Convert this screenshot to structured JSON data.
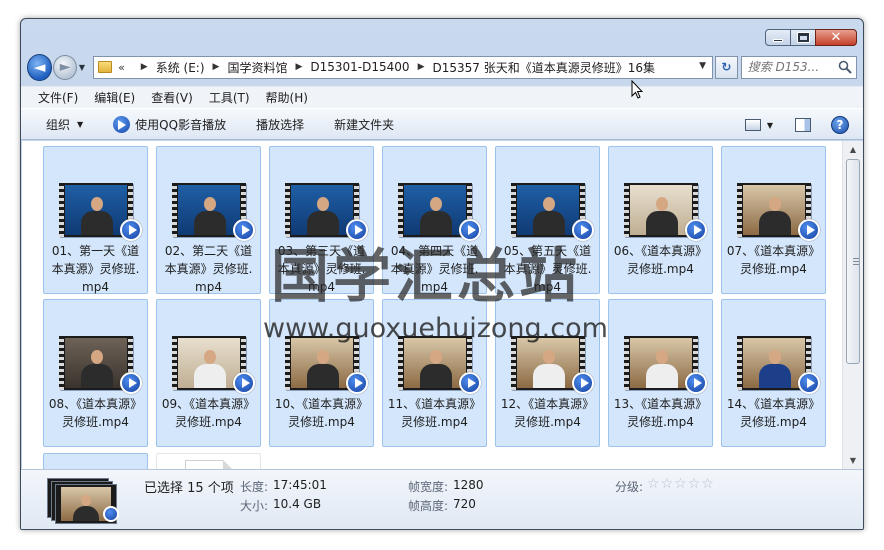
{
  "window": {
    "min_label": "",
    "close_glyph": "✕"
  },
  "nav": {
    "back_glyph": "◄",
    "forward_glyph": "►",
    "history_glyph": "▼"
  },
  "address": {
    "lead": "«",
    "crumbs": [
      "系统 (E:)",
      "国学资料馆",
      "D15301-D15400",
      "D15357 张天和《道本真源灵修班》16集"
    ],
    "separator": "▶",
    "dropdown_glyph": "▼",
    "refresh_glyph": "↻"
  },
  "search": {
    "placeholder": "搜索 D153..."
  },
  "menu": {
    "items": [
      "文件(F)",
      "编辑(E)",
      "查看(V)",
      "工具(T)",
      "帮助(H)"
    ]
  },
  "commands": {
    "organize": "组织",
    "organize_caret": "▼",
    "play_qq": "使用QQ影音播放",
    "play_selection": "播放选择",
    "new_folder": "新建文件夹",
    "views_caret": "▼",
    "help": "?"
  },
  "files": [
    {
      "name": "01、第一天《道本真源》灵修班.mp4",
      "frame": "blue",
      "body": "dark"
    },
    {
      "name": "02、第二天《道本真源》灵修班.mp4",
      "frame": "blue",
      "body": "dark"
    },
    {
      "name": "03、第三天《道本真源》灵修班.mp4",
      "frame": "blue",
      "body": "dark"
    },
    {
      "name": "04、第四天《道本真源》灵修班.mp4",
      "frame": "blue",
      "body": "dark"
    },
    {
      "name": "05、第五天《道本真源》灵修班.mp4",
      "frame": "blue",
      "body": "dark"
    },
    {
      "name": "06、《道本真源》灵修班.mp4",
      "frame": "room",
      "body": "dark"
    },
    {
      "name": "07、《道本真源》灵修班.mp4",
      "frame": "wood",
      "body": "dark"
    },
    {
      "name": "08、《道本真源》灵修班.mp4",
      "frame": "dark",
      "body": "dark"
    },
    {
      "name": "09、《道本真源》灵修班.mp4",
      "frame": "room",
      "body": "white"
    },
    {
      "name": "10、《道本真源》灵修班.mp4",
      "frame": "wood",
      "body": "dark"
    },
    {
      "name": "11、《道本真源》灵修班.mp4",
      "frame": "wood",
      "body": "dark"
    },
    {
      "name": "12、《道本真源》灵修班.mp4",
      "frame": "wood",
      "body": "white"
    },
    {
      "name": "13、《道本真源》灵修班.mp4",
      "frame": "wood",
      "body": "white"
    },
    {
      "name": "14、《道本真源》灵修班.mp4",
      "frame": "wood",
      "body": "navy"
    }
  ],
  "watermark": {
    "cn": "国学汇总站",
    "url": "www.guoxuehuizong.com"
  },
  "details": {
    "selected": "已选择 15 个项",
    "length_label": "长度:",
    "length_value": "17:45:01",
    "size_label": "大小:",
    "size_value": "10.4 GB",
    "width_label": "帧宽度:",
    "width_value": "1280",
    "height_label": "帧高度:",
    "height_value": "720",
    "rating_label": "分级:",
    "rating_stars": 0,
    "rating_max": 5
  },
  "scrollbar": {
    "up_glyph": "▲",
    "down_glyph": "▼"
  },
  "colors": {
    "tile_selected": "#d4e6fb",
    "tile_border": "#9cc3ec",
    "accent_blue": "#1f5fbf",
    "close_red": "#c4402a"
  }
}
